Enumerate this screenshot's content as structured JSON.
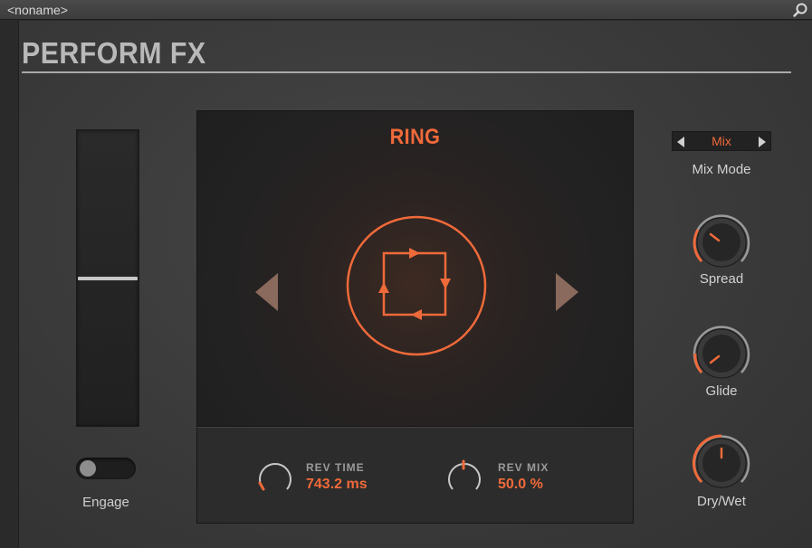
{
  "window": {
    "title": "<noname>"
  },
  "plugin": {
    "title": "PERFORM FX"
  },
  "fader": {
    "level_fraction": 0.5
  },
  "engage": {
    "label": "Engage",
    "on": false
  },
  "display": {
    "effect_name": "RING",
    "icon": "ring-loop-icon",
    "prev_icon": "triangle-left-icon",
    "next_icon": "triangle-right-icon"
  },
  "params": [
    {
      "label": "REV TIME",
      "value": "743.2 ms",
      "knob_fraction": 0.1
    },
    {
      "label": "REV MIX",
      "value": "50.0 %",
      "knob_fraction": 0.5
    }
  ],
  "mix_mode": {
    "value": "Mix",
    "label": "Mix Mode"
  },
  "knobs": {
    "spread": {
      "label": "Spread",
      "fraction": 0.3
    },
    "glide": {
      "label": "Glide",
      "fraction": 0.2
    },
    "dry_wet": {
      "label": "Dry/Wet",
      "fraction": 0.5
    }
  },
  "colors": {
    "accent": "#ef6a3a",
    "display_bg": "#222222",
    "panel_bg": "#3a3a3a",
    "arrow": "#8a6a5c"
  }
}
